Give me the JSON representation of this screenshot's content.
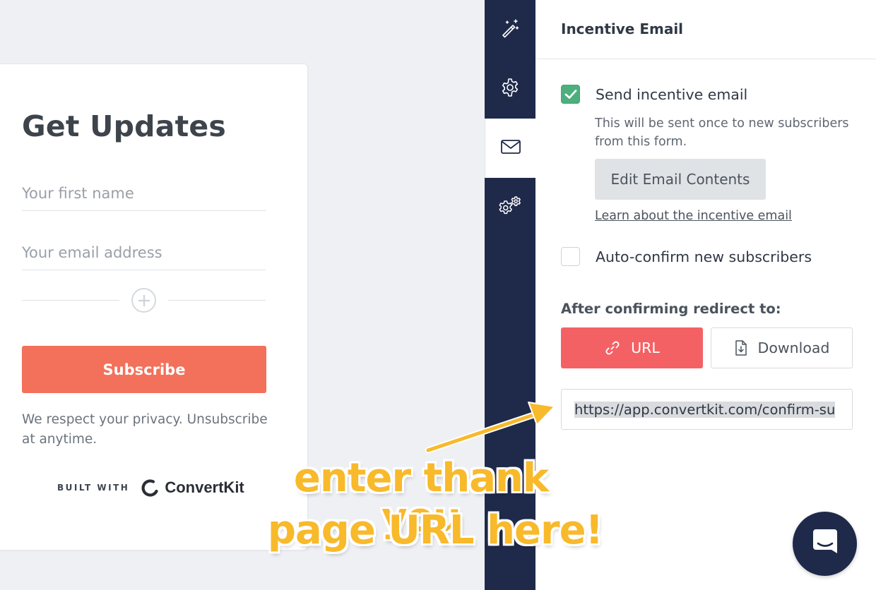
{
  "form": {
    "title": "Get Updates",
    "first_name_placeholder": "Your first name",
    "email_placeholder": "Your email address",
    "subscribe_label": "Subscribe",
    "privacy_text": "We respect your privacy. Unsubscribe at anytime.",
    "built_with_label": "BUILT WITH",
    "brand_name": "ConvertKit"
  },
  "sidenav": {
    "items": [
      {
        "icon": "magic-wand-icon",
        "active": false
      },
      {
        "icon": "gear-icon",
        "active": false
      },
      {
        "icon": "envelope-icon",
        "active": true
      },
      {
        "icon": "gears-icon",
        "active": false
      }
    ]
  },
  "panel": {
    "title": "Incentive Email",
    "send_incentive": {
      "label": "Send incentive email",
      "checked": true
    },
    "description": "This will be sent once to new subscribers from this form.",
    "edit_button": "Edit Email Contents",
    "learn_link": "Learn about the incentive email",
    "auto_confirm": {
      "label": "Auto-confirm new subscribers",
      "checked": false
    },
    "redirect_label": "After confirming redirect to:",
    "redirect_options": {
      "url": "URL",
      "download": "Download",
      "selected": "URL"
    },
    "redirect_url": "https://app.convertkit.com/confirm-su"
  },
  "annotation": {
    "line1": "enter thank you",
    "line2": "page URL here!"
  },
  "colors": {
    "navy": "#1f2a4a",
    "subscribe": "#f3705a",
    "url_button": "#f46165",
    "check_green": "#4caf7d",
    "annotation": "#f8b92b"
  }
}
